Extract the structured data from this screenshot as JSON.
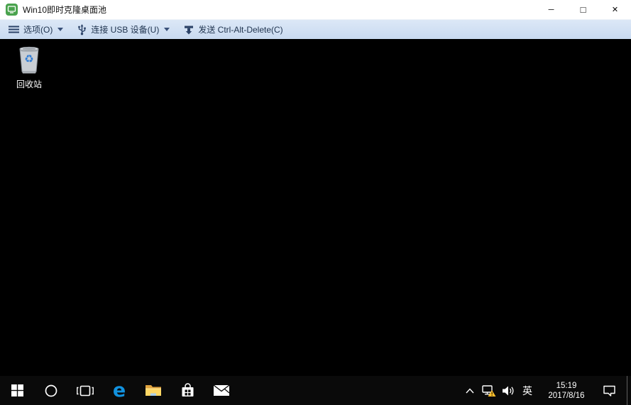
{
  "window": {
    "title": "Win10即时克隆桌面池",
    "app_icon": "horizon-client-monitor",
    "controls": {
      "minimize_glyph": "─",
      "maximize_glyph": "□",
      "close_glyph": "✕"
    }
  },
  "toolbar": {
    "background": "#cfdff1",
    "text_color": "#20344f",
    "options_label": "选项(O)",
    "usb_label": "连接 USB 设备(U)",
    "send_label": "发送 Ctrl-Alt-Delete(C)"
  },
  "desktop": {
    "background": "#000000",
    "recycle_bin": {
      "label": "回收站",
      "recycle_glyph": "♻"
    }
  },
  "taskbar": {
    "background": "#0a0a0a",
    "left_icons": [
      {
        "name": "start"
      },
      {
        "name": "cortana-search"
      },
      {
        "name": "task-view"
      },
      {
        "name": "edge"
      },
      {
        "name": "file-explorer"
      },
      {
        "name": "store"
      },
      {
        "name": "mail"
      }
    ],
    "edge_glyph": "e",
    "tray": {
      "hidden_icons_chevron": "^",
      "network_status": "warning",
      "language_indicator": "英",
      "time": "15:19",
      "date": "2017/8/16"
    }
  },
  "colors": {
    "edge_blue": "#1292df",
    "folder_front": "#ffd764",
    "folder_back": "#e0a33e",
    "warning_yellow": "#fdbf2d",
    "horizon_green": "#4aa34e",
    "recycle_blue": "#2e7cd6"
  }
}
